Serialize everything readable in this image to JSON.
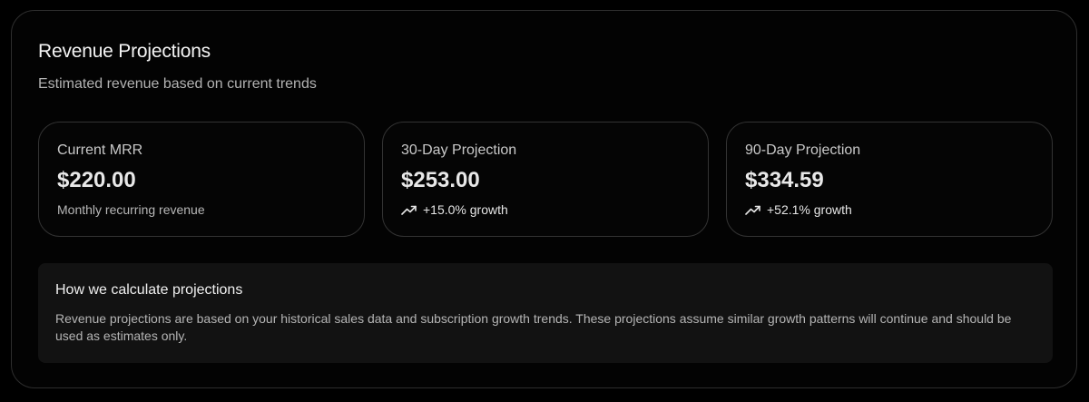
{
  "header": {
    "title": "Revenue Projections",
    "subtitle": "Estimated revenue based on current trends"
  },
  "cards": [
    {
      "label": "Current MRR",
      "value": "$220.00",
      "note": "Monthly recurring revenue",
      "icon": null
    },
    {
      "label": "30-Day Projection",
      "value": "$253.00",
      "note": "+15.0% growth",
      "icon": "trending-up-icon"
    },
    {
      "label": "90-Day Projection",
      "value": "$334.59",
      "note": "+52.1% growth",
      "icon": "trending-up-icon"
    }
  ],
  "info": {
    "title": "How we calculate projections",
    "body": "Revenue projections are based on your historical sales data and subscription growth trends. These projections assume similar growth patterns will continue and should be used as estimates only."
  },
  "colors": {
    "background": "#000000",
    "card_border": "#333333",
    "info_background": "#121212"
  }
}
